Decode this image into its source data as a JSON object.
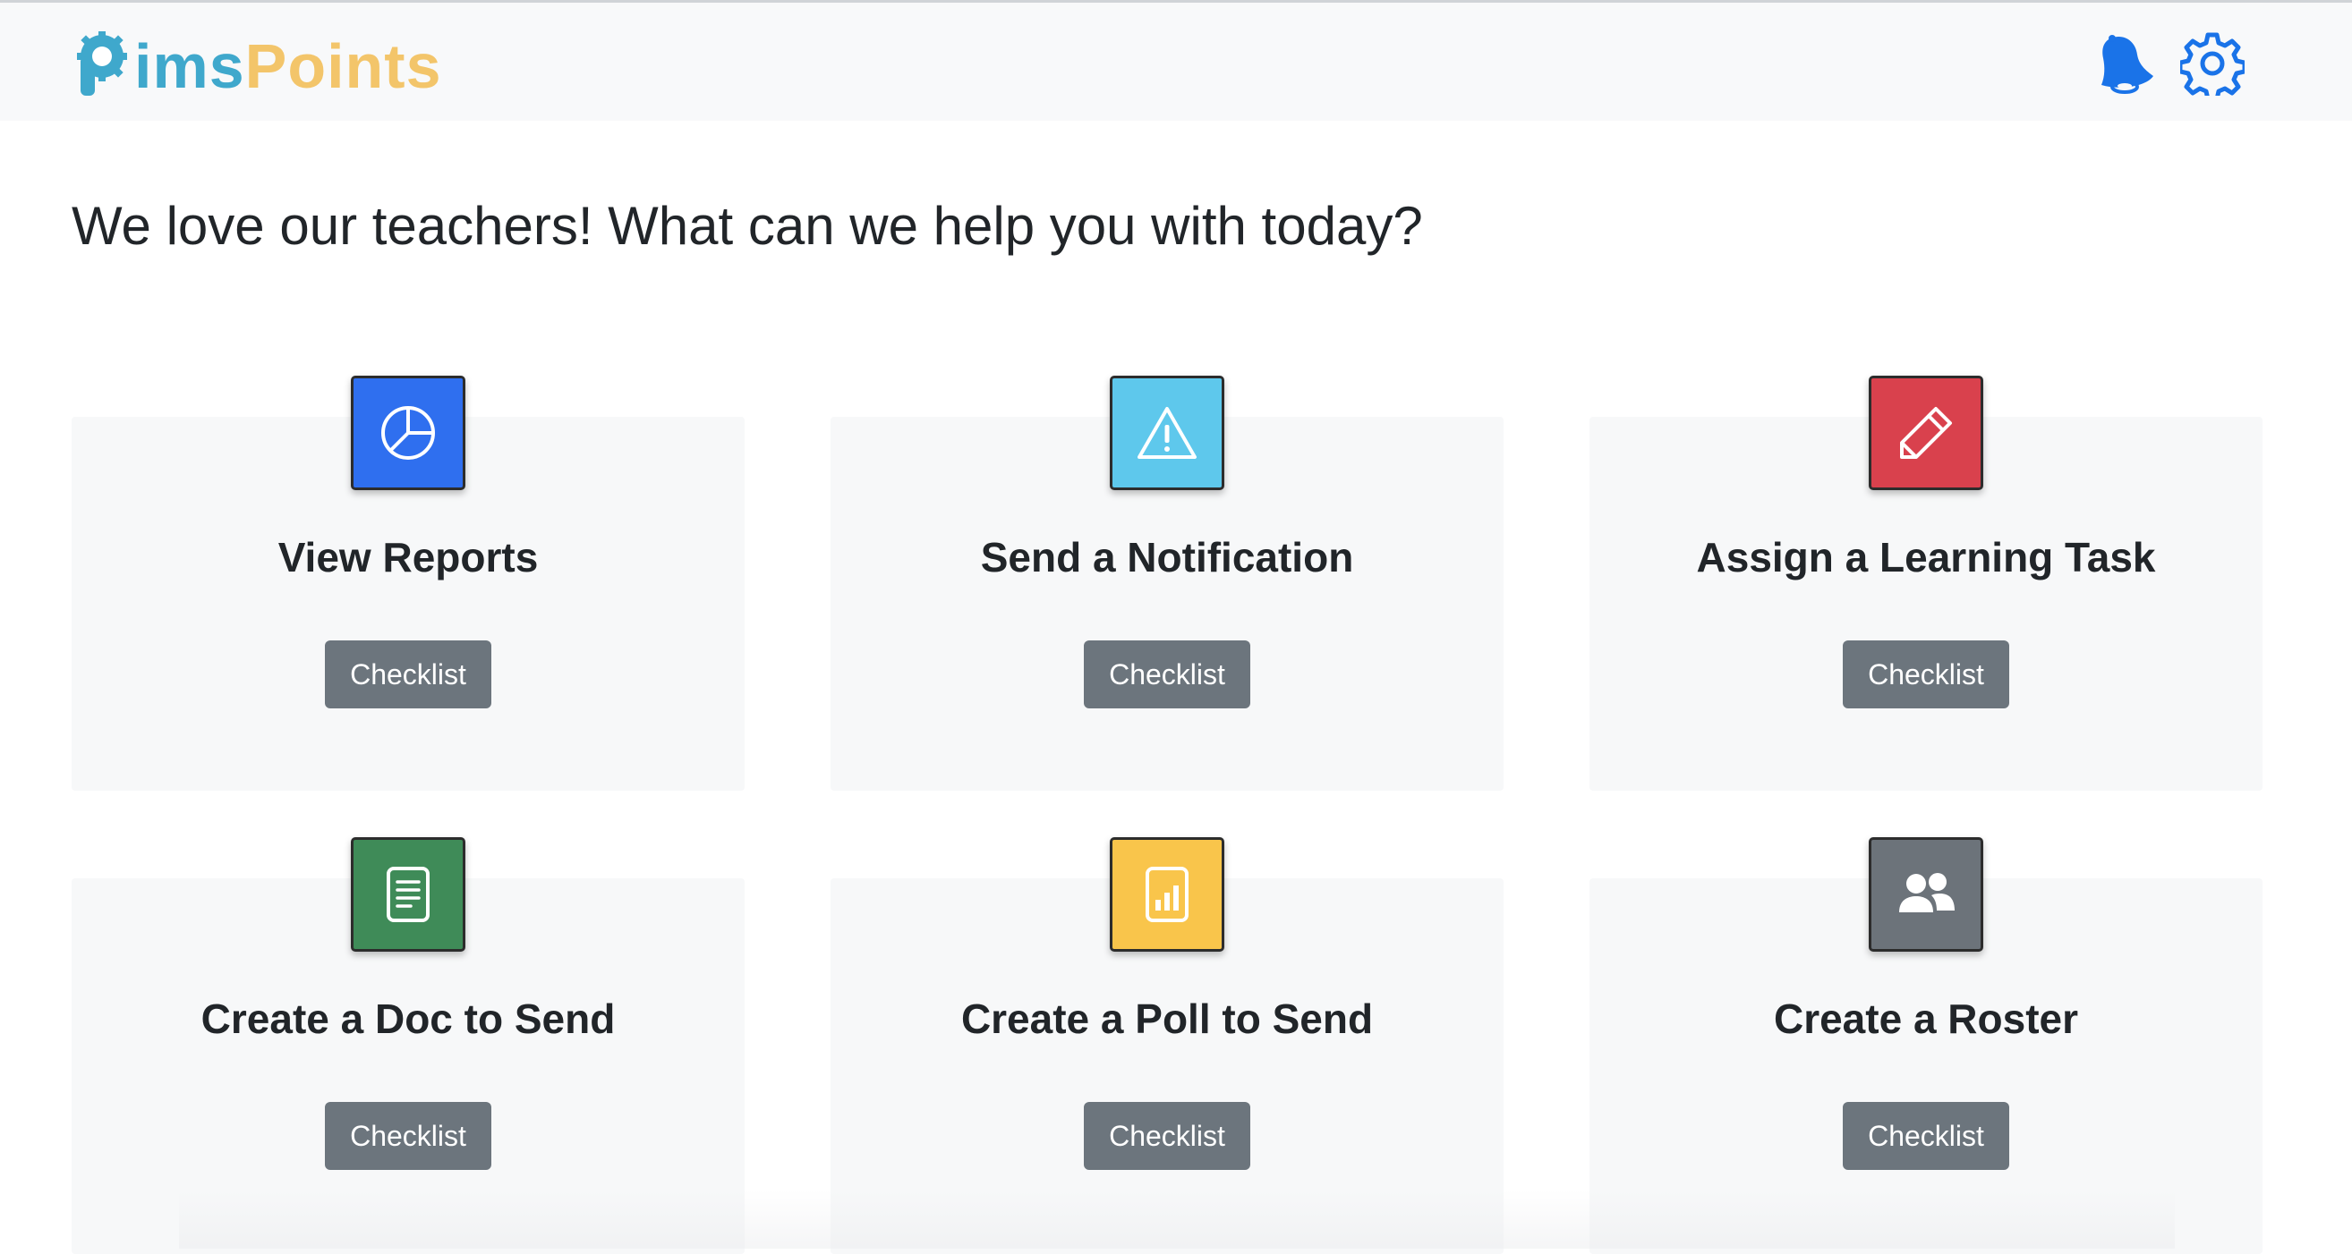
{
  "brand": {
    "part1": "imsPoints",
    "part1_prefix": "P",
    "color_primary": "#3fa8cc",
    "color_secondary": "#f3c56a"
  },
  "nav": {
    "icons": [
      "bell-icon",
      "gear-icon"
    ],
    "icon_color": "#1a73e8"
  },
  "headline": "We love our teachers! What can we help you with today?",
  "cards": [
    {
      "title": "View Reports",
      "button": "Checklist",
      "icon": "pie-chart-icon",
      "tile_color": "#2f6fef"
    },
    {
      "title": "Send a Notification",
      "button": "Checklist",
      "icon": "warning-icon",
      "tile_color": "#5ec8ec"
    },
    {
      "title": "Assign a Learning Task",
      "button": "Checklist",
      "icon": "pencil-icon",
      "tile_color": "#d9414d"
    },
    {
      "title": "Create a Doc to Send",
      "button": "Checklist",
      "icon": "document-icon",
      "tile_color": "#3f8b58"
    },
    {
      "title": "Create a Poll to Send",
      "button": "Checklist",
      "icon": "poll-icon",
      "tile_color": "#f9c54b"
    },
    {
      "title": "Create a Roster",
      "button": "Checklist",
      "icon": "users-icon",
      "tile_color": "#6c737a"
    }
  ]
}
